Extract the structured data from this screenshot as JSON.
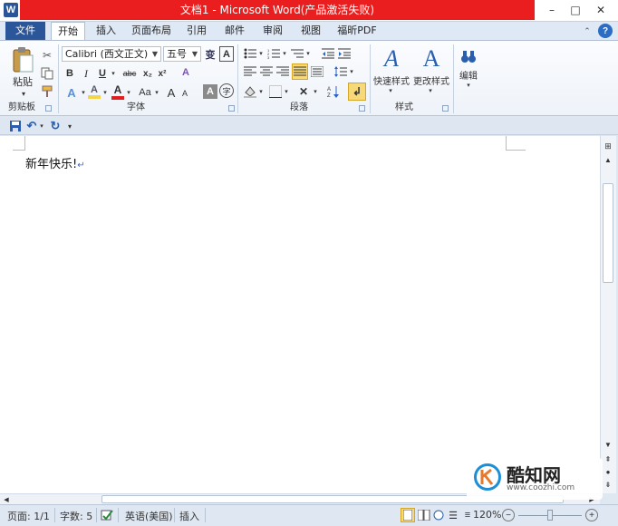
{
  "window": {
    "title": "文档1 - Microsoft Word(产品激活失败)",
    "logo_letter": "W",
    "minimize": "–",
    "maximize": "□",
    "close": "✕"
  },
  "tabs": {
    "file": "文件",
    "items": [
      "开始",
      "插入",
      "页面布局",
      "引用",
      "邮件",
      "审阅",
      "视图",
      "福昕PDF"
    ],
    "help": "?"
  },
  "ribbon": {
    "clipboard": {
      "paste": "粘贴",
      "group": "剪贴板"
    },
    "font": {
      "font_name": "Calibri (西文正文)",
      "font_size": "五号",
      "wen": "变",
      "a_box": "A",
      "bold": "B",
      "italic": "I",
      "underline": "U",
      "strike": "abc",
      "sub": "x₂",
      "sup": "x²",
      "clear": "A",
      "highlight": "A",
      "fontcolor": "A",
      "case": "Aa",
      "grow": "A",
      "shrink": "A",
      "charshade": "A",
      "enclose": "字",
      "group": "字体"
    },
    "paragraph": {
      "group": "段落"
    },
    "styles": {
      "quick": "快速样式",
      "change": "更改样式",
      "group": "样式"
    },
    "editing": {
      "label": "编辑"
    }
  },
  "document": {
    "text": "新年快乐!",
    "para_mark": "↵"
  },
  "status": {
    "page": "页面: 1/1",
    "words": "字数: 5",
    "language": "英语(美国)",
    "mode": "插入",
    "zoom": "120%"
  },
  "watermark": {
    "brand": "酷知网",
    "url": "www.coozhi.com"
  },
  "colors": {
    "title_red": "#ea1e1e",
    "file_tab": "#2b579a",
    "highlight_yellow": "#f4d54a",
    "font_red": "#e02020"
  }
}
